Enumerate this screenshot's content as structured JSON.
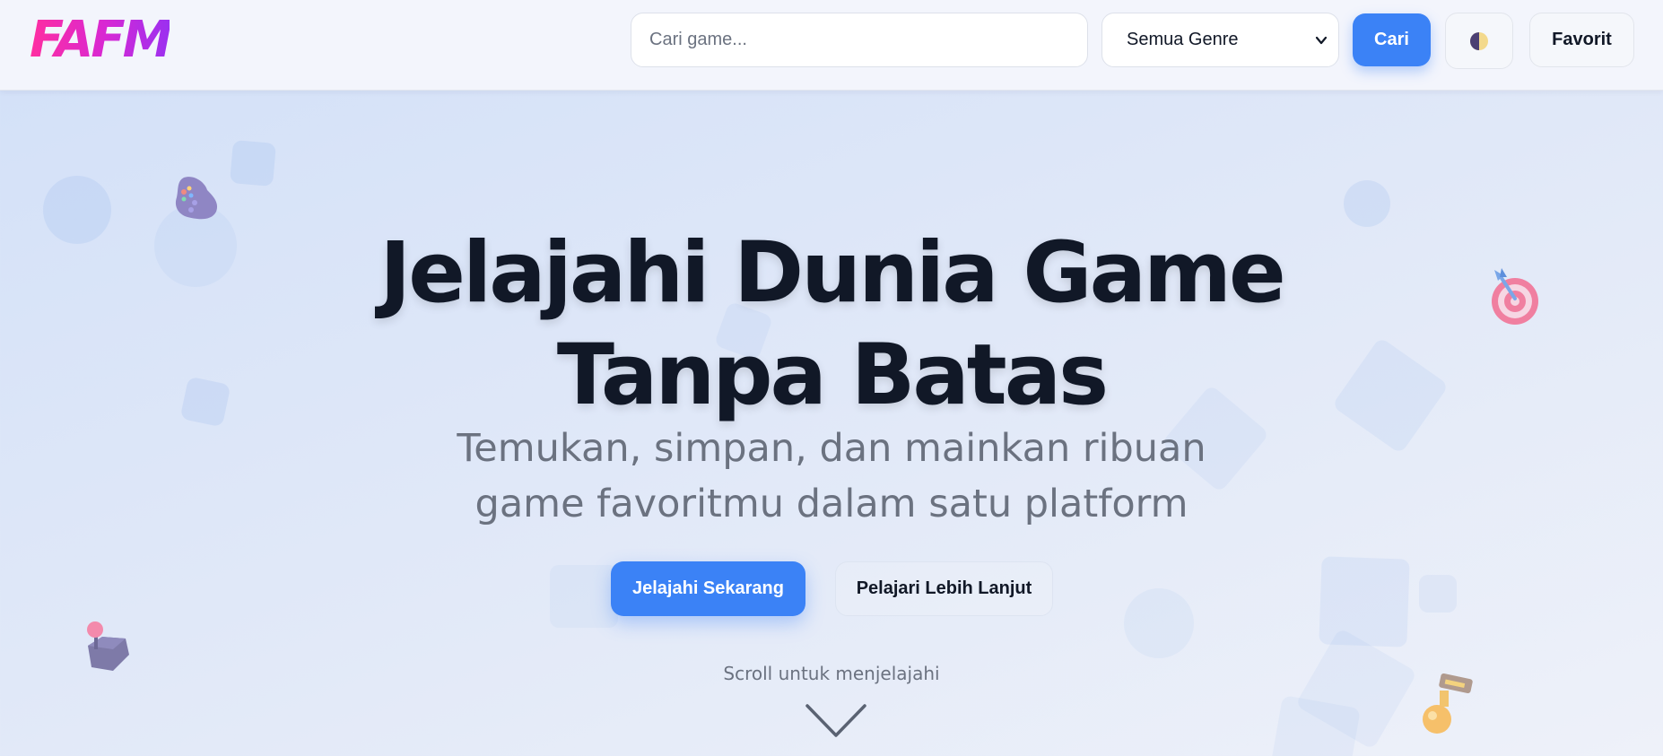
{
  "header": {
    "logo": "FAFM",
    "search_placeholder": "Cari game...",
    "genre_selected": "Semua Genre",
    "search_button": "Cari",
    "theme_icon": "half-moon-theme-icon",
    "favorite_button": "Favorit"
  },
  "hero": {
    "title_line1": "Jelajahi Dunia Game",
    "title_line2": "Tanpa Batas",
    "subtitle_line1": "Temukan, simpan, dan mainkan ribuan",
    "subtitle_line2": "game favoritmu dalam satu platform",
    "primary_button": "Jelajahi Sekarang",
    "secondary_button": "Pelajari Lebih Lanjut",
    "scroll_hint": "Scroll untuk menjelajahi",
    "scroll_icon": "chevron-down-icon"
  },
  "decorations": [
    "gamepad-icon",
    "target-icon",
    "joystick-icon",
    "trophy-icon"
  ],
  "colors": {
    "accent": "#3b82f6",
    "logo_gradient": [
      "#ff2ea0",
      "#9b30f0"
    ],
    "title": "#111827",
    "muted": "#6b7280"
  }
}
